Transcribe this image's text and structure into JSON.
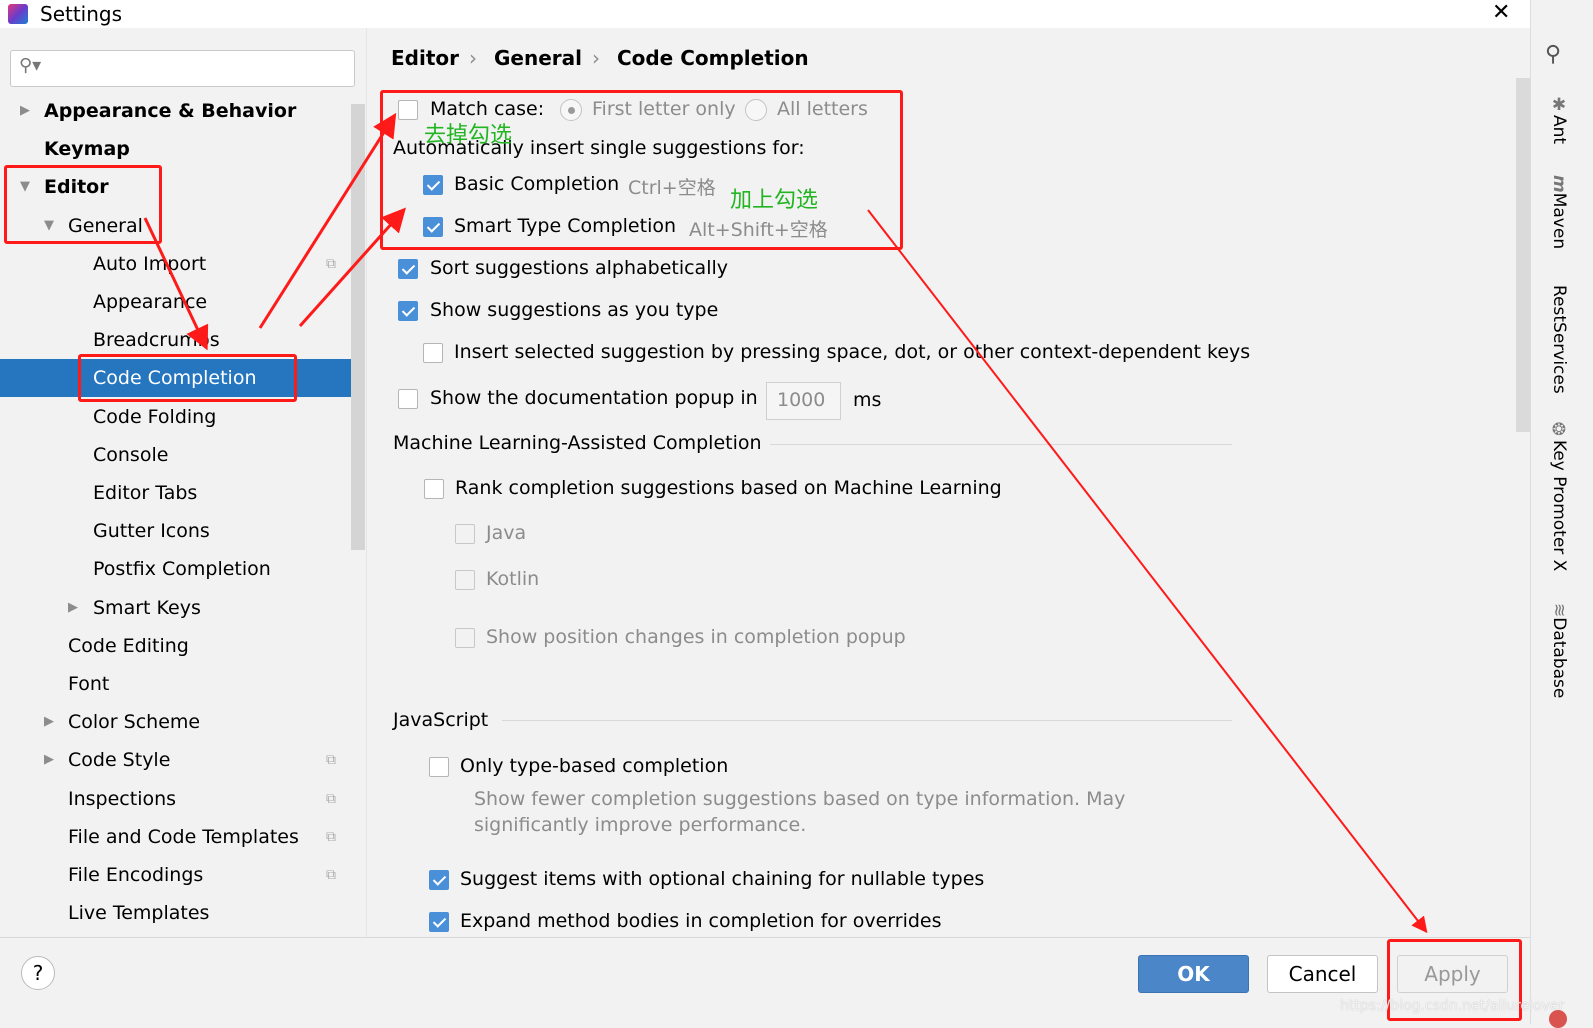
{
  "window": {
    "title": "Settings",
    "close_icon": "close-icon"
  },
  "search": {
    "placeholder": "",
    "value": ""
  },
  "sidebar": {
    "items": [
      {
        "label": "Appearance & Behavior",
        "bold": true,
        "expander": "collapsed"
      },
      {
        "label": "Keymap",
        "bold": true
      },
      {
        "label": "Editor",
        "bold": true,
        "expander": "expanded"
      },
      {
        "label": "General",
        "expander": "expanded"
      },
      {
        "label": "Auto Import",
        "copy_icon": true
      },
      {
        "label": "Appearance"
      },
      {
        "label": "Breadcrumbs"
      },
      {
        "label": "Code Completion",
        "selected": true
      },
      {
        "label": "Code Folding"
      },
      {
        "label": "Console"
      },
      {
        "label": "Editor Tabs"
      },
      {
        "label": "Gutter Icons"
      },
      {
        "label": "Postfix Completion"
      },
      {
        "label": "Smart Keys",
        "expander": "collapsed"
      },
      {
        "label": "Code Editing"
      },
      {
        "label": "Font"
      },
      {
        "label": "Color Scheme",
        "expander": "collapsed"
      },
      {
        "label": "Code Style",
        "expander": "collapsed",
        "copy_icon": true
      },
      {
        "label": "Inspections",
        "copy_icon": true
      },
      {
        "label": "File and Code Templates",
        "copy_icon": true
      },
      {
        "label": "File Encodings",
        "copy_icon": true
      },
      {
        "label": "Live Templates"
      }
    ]
  },
  "breadcrumb": [
    "Editor",
    "General",
    "Code Completion"
  ],
  "main": {
    "match_case": {
      "label": "Match case:",
      "checked": false
    },
    "first_letter": {
      "label": "First letter only",
      "selected": true
    },
    "all_letters": {
      "label": "All letters",
      "selected": false
    },
    "auto_insert_label": "Automatically insert single suggestions for:",
    "basic": {
      "label": "Basic Completion",
      "shortcut": "Ctrl+空格",
      "checked": true
    },
    "smart": {
      "label": "Smart Type Completion",
      "shortcut": "Alt+Shift+空格",
      "checked": true
    },
    "sort": {
      "label": "Sort suggestions alphabetically",
      "checked": true
    },
    "show_as_type": {
      "label": "Show suggestions as you type",
      "checked": true
    },
    "insert_selected": {
      "label": "Insert selected suggestion by pressing space, dot, or other context-dependent keys",
      "checked": false
    },
    "doc_popup": {
      "label": "Show the documentation popup in",
      "value": "1000",
      "unit": "ms",
      "checked": false
    },
    "ml_section": "Machine Learning-Assisted Completion",
    "ml_rank": {
      "label": "Rank completion suggestions based on Machine Learning",
      "checked": false
    },
    "ml_java": {
      "label": "Java",
      "checked": false
    },
    "ml_kotlin": {
      "label": "Kotlin",
      "checked": false
    },
    "ml_position": {
      "label": "Show position changes in completion popup",
      "checked": false
    },
    "js_section": "JavaScript",
    "js_type": {
      "label": "Only type-based completion",
      "checked": false
    },
    "js_type_desc1": "Show fewer completion suggestions based on type information. May",
    "js_type_desc2": "significantly improve performance.",
    "js_optional": {
      "label": "Suggest items with optional chaining for nullable types",
      "checked": true
    },
    "js_expand": {
      "label": "Expand method bodies in completion for overrides",
      "checked": true
    }
  },
  "buttons": {
    "ok": "OK",
    "cancel": "Cancel",
    "apply": "Apply",
    "help": "?"
  },
  "tool_strip": [
    "Ant",
    "Maven",
    "RestServices",
    "Key Promoter X",
    "Database"
  ],
  "annotations": {
    "uncheck": "去掉勾选",
    "check": "加上勾选",
    "color": "#ff1a1a"
  },
  "watermark": "https://blog.csdn.net/allurelover",
  "colors": {
    "accent": "#2675bf",
    "checkbox": "#4a90d9",
    "ok_button": "#4a86c8"
  }
}
